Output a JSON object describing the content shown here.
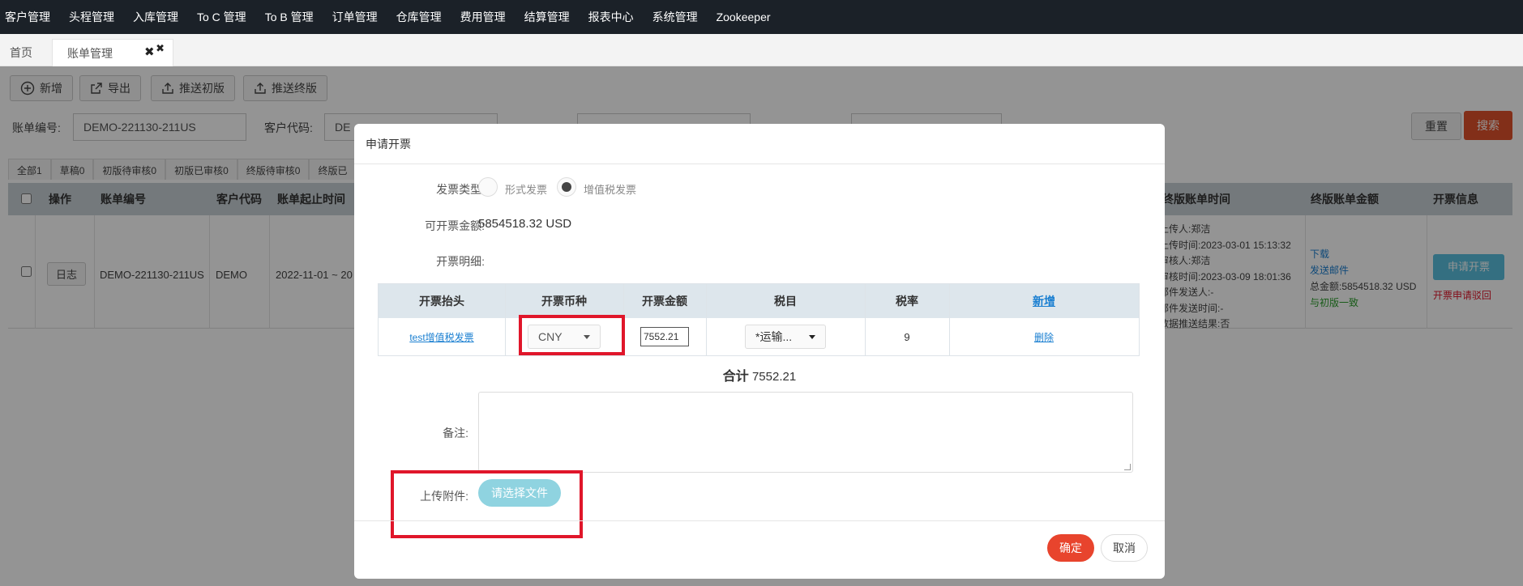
{
  "nav": {
    "items": [
      "客户管理",
      "头程管理",
      "入库管理",
      "To C 管理",
      "To B 管理",
      "订单管理",
      "仓库管理",
      "费用管理",
      "结算管理",
      "报表中心",
      "系统管理",
      "Zookeeper"
    ]
  },
  "tabs": {
    "home": "首页",
    "bill": "账单管理",
    "close_glyph": "✖"
  },
  "toolbar": {
    "add": "新增",
    "export": "导出",
    "push_initial": "推送初版",
    "push_final": "推送终版"
  },
  "filters": {
    "bill_no_label": "账单编号:",
    "bill_no_value": "DEMO-221130-211US",
    "customer_code_label": "客户代码:",
    "customer_code_value": "DE",
    "reset": "重置",
    "search": "搜索"
  },
  "status_tabs": [
    "全部1",
    "草稿0",
    "初版待审核0",
    "初版已审核0",
    "终版待审核0",
    "终版已"
  ],
  "table": {
    "headers": {
      "action": "操作",
      "bill_no": "账单编号",
      "customer": "客户代码",
      "period": "账单起止时间",
      "final_time": "终版账单时间",
      "final_amount": "终版账单金额",
      "invoice_info": "开票信息"
    },
    "row": {
      "log": "日志",
      "bill_no": "DEMO-221130-211US",
      "customer": "DEMO",
      "period": "2022-11-01 ~ 20",
      "final_time_lines": [
        "上传人:郑洁",
        "上传时间:2023-03-01 15:13:32",
        "审核人:郑洁",
        "审核时间:2023-03-09 18:01:36",
        "邮件发送人:-",
        "邮件发送时间:-",
        "数据推送结果:否"
      ],
      "download": "下载",
      "send_mail": "发送邮件",
      "total_amount": "总金额:5854518.32 USD",
      "match_initial": "与初版一致",
      "apply_invoice": "申请开票",
      "apply_rejected": "开票申请驳回"
    }
  },
  "modal": {
    "title": "申请开票",
    "invoice_type_label": "发票类型:",
    "type_proforma": "形式发票",
    "type_vat": "增值税发票",
    "available_label": "可开票金额:",
    "available_value": "5854518.32 USD",
    "detail_label": "开票明细:",
    "detail_table": {
      "headers": [
        "开票抬头",
        "开票币种",
        "开票金额",
        "税目",
        "税率",
        "新增"
      ],
      "row": {
        "title": "test增值税发票",
        "currency": "CNY",
        "amount": "7552.21",
        "tax_item": "*运输...",
        "tax_rate": "9",
        "delete": "删除"
      }
    },
    "total_label": "合计",
    "total_value": "7552.21",
    "remark_label": "备注:",
    "remark_value": "",
    "upload_label": "上传附件:",
    "upload_button": "请选择文件",
    "confirm": "确定",
    "cancel": "取消"
  },
  "colors": {
    "nav_bg": "#1b2128",
    "accent_red": "#e8442d",
    "highlight_box": "#e0162a",
    "file_btn": "#8fd3e0",
    "link": "#1a7fd1"
  }
}
